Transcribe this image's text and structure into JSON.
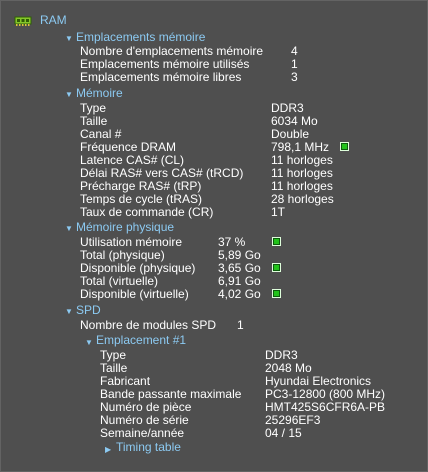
{
  "root": {
    "title": "RAM"
  },
  "slots": {
    "title": "Emplacements mémoire",
    "rows": [
      {
        "label": "Nombre d'emplacements mémoire",
        "value": "4"
      },
      {
        "label": "Emplacements mémoire utilisés",
        "value": "1"
      },
      {
        "label": "Emplacements mémoire libres",
        "value": "3"
      }
    ]
  },
  "memory": {
    "title": "Mémoire",
    "rows": [
      {
        "label": "Type",
        "value": "DDR3"
      },
      {
        "label": "Taille",
        "value": "6034 Mo"
      },
      {
        "label": "Canal #",
        "value": "Double"
      },
      {
        "label": "Fréquence DRAM",
        "value": "798,1 MHz"
      },
      {
        "label": "Latence CAS# (CL)",
        "value": "11 horloges"
      },
      {
        "label": "Délai RAS# vers CAS# (tRCD)",
        "value": "11 horloges"
      },
      {
        "label": "Précharge RAS# (tRP)",
        "value": "11 horloges"
      },
      {
        "label": "Temps de cycle (tRAS)",
        "value": "28 horloges"
      },
      {
        "label": "Taux de commande (CR)",
        "value": "1T"
      }
    ]
  },
  "physical": {
    "title": "Mémoire physique",
    "rows": [
      {
        "label": "Utilisation mémoire",
        "value": "37 %"
      },
      {
        "label": "Total (physique)",
        "value": "5,89 Go"
      },
      {
        "label": "Disponible (physique)",
        "value": "3,65 Go"
      },
      {
        "label": "Total (virtuelle)",
        "value": "6,91 Go"
      },
      {
        "label": "Disponible (virtuelle)",
        "value": "4,02 Go"
      }
    ]
  },
  "spd": {
    "title": "SPD",
    "modules_label": "Nombre de modules SPD",
    "modules_value": "1",
    "slot": {
      "title": "Emplacement #1",
      "rows": [
        {
          "label": "Type",
          "value": "DDR3"
        },
        {
          "label": "Taille",
          "value": "2048 Mo"
        },
        {
          "label": "Fabricant",
          "value": "Hyundai Electronics"
        },
        {
          "label": "Bande passante maximale",
          "value": "PC3-12800 (800 MHz)"
        },
        {
          "label": "Numéro de pièce",
          "value": "HMT425S6CFR6A-PB"
        },
        {
          "label": "Numéro de série",
          "value": "25296EF3"
        },
        {
          "label": "Semaine/année",
          "value": "04 / 15"
        }
      ],
      "timing_table": "Timing table"
    }
  },
  "colors": {
    "background": "#4f4f4f",
    "section": "#8ccaf2",
    "text": "#ffffff",
    "indicator": "#22c31a"
  },
  "icons": {
    "root": "ram-chip-icon",
    "expanded": "triangle-down-icon",
    "collapsed": "triangle-right-icon",
    "status": "green-square-indicator"
  }
}
